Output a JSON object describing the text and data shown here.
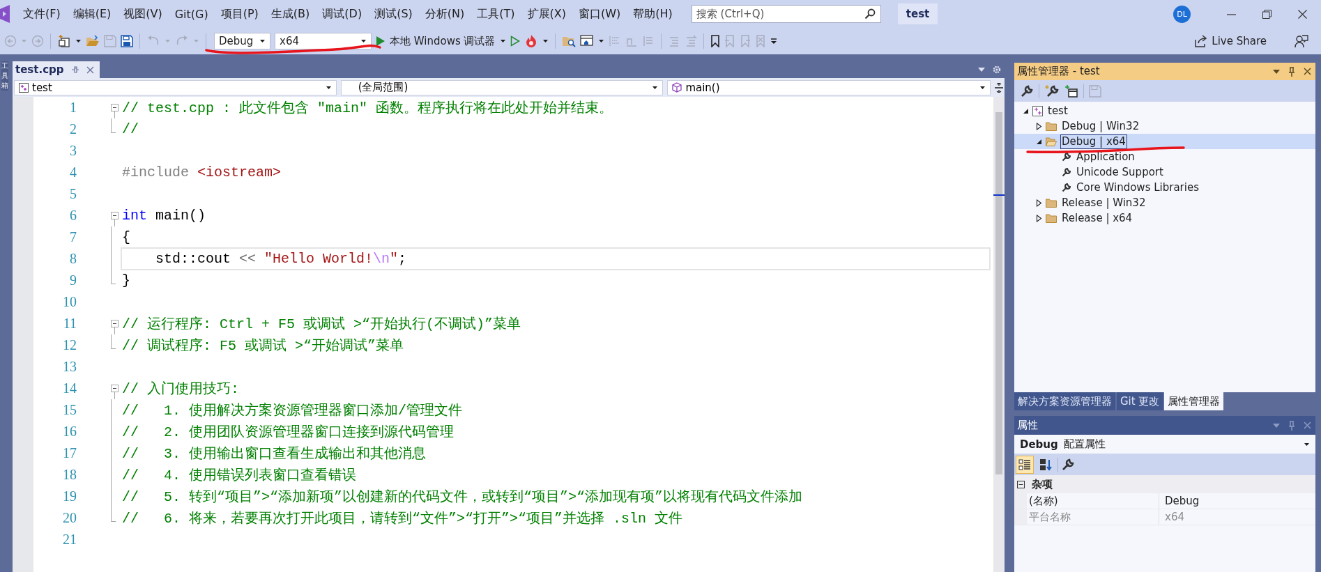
{
  "menu_bar": {
    "items": [
      "文件(F)",
      "编辑(E)",
      "视图(V)",
      "Git(G)",
      "项目(P)",
      "生成(B)",
      "调试(D)",
      "测试(S)",
      "分析(N)",
      "工具(T)",
      "扩展(X)",
      "窗口(W)",
      "帮助(H)"
    ],
    "search": {
      "placeholder": "搜索 (Ctrl+Q)"
    },
    "solution_name": "test",
    "account_initials": "DL"
  },
  "toolbar": {
    "configuration": "Debug",
    "platform": "x64",
    "run_label": "本地 Windows 调试器",
    "live_share": "Live Share"
  },
  "side_tab": {
    "label": "工具箱"
  },
  "editor": {
    "tabs": [
      {
        "label": "test.cpp",
        "selected": true
      }
    ],
    "nav": {
      "project": "test",
      "scope": "(全局范围)",
      "member": "main()"
    },
    "lines": [
      {
        "number": "1",
        "fold": {
          "kind": "start"
        },
        "current": false,
        "tokens": [
          {
            "kind": "comment",
            "text": "// test.cpp : 此文件包含 \"main\" 函数。程序执行将在此处开始并结束。"
          }
        ]
      },
      {
        "number": "2",
        "fold": {
          "kind": "end"
        },
        "current": false,
        "tokens": [
          {
            "kind": "comment",
            "text": "//"
          }
        ]
      },
      {
        "number": "3",
        "current": false
      },
      {
        "number": "4",
        "current": false,
        "tokens": [
          {
            "kind": "preproc",
            "text": "#include "
          },
          {
            "kind": "string",
            "text": "<iostream>"
          }
        ]
      },
      {
        "number": "5",
        "current": false
      },
      {
        "number": "6",
        "fold": {
          "kind": "start"
        },
        "current": false,
        "tokens": [
          {
            "kind": "keyword",
            "text": "int"
          },
          {
            "kind": "plain",
            "text": " main()"
          }
        ]
      },
      {
        "number": "7",
        "fold": {
          "kind": "middle"
        },
        "current": false,
        "tokens": [
          {
            "kind": "plain",
            "text": "{"
          }
        ]
      },
      {
        "number": "8",
        "fold": {
          "kind": "middle"
        },
        "current": true,
        "tokens": [
          {
            "kind": "plain",
            "text": "    std::cout "
          },
          {
            "kind": "operator",
            "text": "<< "
          },
          {
            "kind": "string",
            "text": "\"Hello World!"
          },
          {
            "kind": "escape",
            "text": "\\n"
          },
          {
            "kind": "string",
            "text": "\""
          },
          {
            "kind": "plain",
            "text": ";"
          }
        ]
      },
      {
        "number": "9",
        "fold": {
          "kind": "end"
        },
        "current": false,
        "tokens": [
          {
            "kind": "plain",
            "text": "}"
          }
        ]
      },
      {
        "number": "10",
        "current": false
      },
      {
        "number": "11",
        "fold": {
          "kind": "start"
        },
        "current": false,
        "tokens": [
          {
            "kind": "comment",
            "text": "// 运行程序: Ctrl + F5 或调试 >“开始执行(不调试)”菜单"
          }
        ]
      },
      {
        "number": "12",
        "fold": {
          "kind": "end"
        },
        "current": false,
        "tokens": [
          {
            "kind": "comment",
            "text": "// 调试程序: F5 或调试 >“开始调试”菜单"
          }
        ]
      },
      {
        "number": "13",
        "current": false
      },
      {
        "number": "14",
        "fold": {
          "kind": "start"
        },
        "current": false,
        "tokens": [
          {
            "kind": "comment",
            "text": "// 入门使用技巧: "
          }
        ]
      },
      {
        "number": "15",
        "fold": {
          "kind": "middle"
        },
        "current": false,
        "tokens": [
          {
            "kind": "comment",
            "text": "//   1. 使用解决方案资源管理器窗口添加/管理文件"
          }
        ]
      },
      {
        "number": "16",
        "fold": {
          "kind": "middle"
        },
        "current": false,
        "tokens": [
          {
            "kind": "comment",
            "text": "//   2. 使用团队资源管理器窗口连接到源代码管理"
          }
        ]
      },
      {
        "number": "17",
        "fold": {
          "kind": "middle"
        },
        "current": false,
        "tokens": [
          {
            "kind": "comment",
            "text": "//   3. 使用输出窗口查看生成输出和其他消息"
          }
        ]
      },
      {
        "number": "18",
        "fold": {
          "kind": "middle"
        },
        "current": false,
        "tokens": [
          {
            "kind": "comment",
            "text": "//   4. 使用错误列表窗口查看错误"
          }
        ]
      },
      {
        "number": "19",
        "fold": {
          "kind": "middle"
        },
        "current": false,
        "tokens": [
          {
            "kind": "comment",
            "text": "//   5. 转到“项目”>“添加新项”以创建新的代码文件，或转到“项目”>“添加现有项”以将现有代码文件添加"
          }
        ]
      },
      {
        "number": "20",
        "fold": {
          "kind": "end"
        },
        "current": false,
        "tokens": [
          {
            "kind": "comment",
            "text": "//   6. 将来，若要再次打开此项目，请转到“文件”>“打开”>“项目”并选择 .sln 文件"
          }
        ]
      },
      {
        "number": "21",
        "current": false
      }
    ]
  },
  "property_manager": {
    "title": "属性管理器 - test",
    "tree": [
      {
        "label": "test",
        "kind": "project",
        "expanded": true,
        "selected": false,
        "children": [
          {
            "label": "Debug | Win32",
            "kind": "config",
            "expanded": false,
            "selected": false
          },
          {
            "label": "Debug | x64",
            "kind": "config",
            "expanded": true,
            "selected": true,
            "children": [
              {
                "label": "Application",
                "kind": "sheet",
                "selected": false
              },
              {
                "label": "Unicode Support",
                "kind": "sheet",
                "selected": false
              },
              {
                "label": "Core Windows Libraries",
                "kind": "sheet",
                "selected": false
              }
            ]
          },
          {
            "label": "Release | Win32",
            "kind": "config",
            "expanded": false,
            "selected": false
          },
          {
            "label": "Release | x64",
            "kind": "config",
            "expanded": false,
            "selected": false
          }
        ]
      }
    ]
  },
  "panel_tabs": [
    {
      "label": "解决方案资源管理器",
      "selected": false
    },
    {
      "label": "Git 更改",
      "selected": false
    },
    {
      "label": "属性管理器",
      "selected": true
    }
  ],
  "properties": {
    "title": "属性",
    "object_name": "Debug",
    "object_type": "配置属性",
    "view_buttons": [
      {
        "kind": "categorized",
        "selected": true
      },
      {
        "kind": "alphabetical",
        "selected": false
      }
    ],
    "category": {
      "label": "杂项",
      "expanded": true
    },
    "rows": [
      {
        "name": "(名称)",
        "value": "Debug",
        "readonly": false
      },
      {
        "name": "平台名称",
        "value": "x64",
        "readonly": true
      }
    ]
  }
}
